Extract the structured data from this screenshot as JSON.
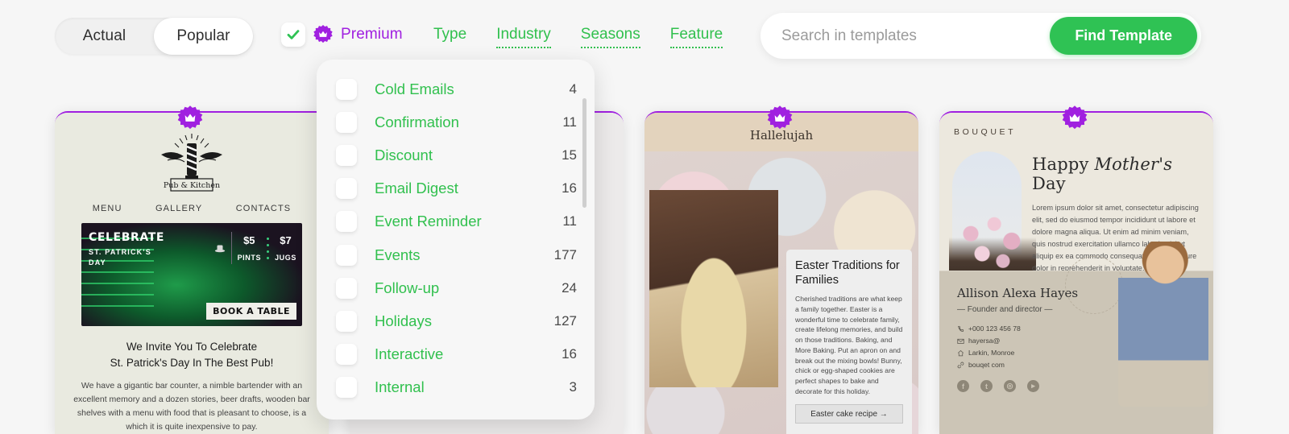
{
  "toolbar": {
    "toggle": {
      "options": [
        "Actual",
        "Popular"
      ],
      "selected": "Popular"
    },
    "premium": {
      "label": "Premium",
      "checked": true,
      "icon": "crown-badge-icon",
      "color": "#a020e0"
    },
    "filters": [
      {
        "label": "Type",
        "active": true
      },
      {
        "label": "Industry",
        "active": false
      },
      {
        "label": "Seasons",
        "active": false
      },
      {
        "label": "Feature",
        "active": false
      }
    ],
    "search": {
      "placeholder": "Search in templates",
      "value": "",
      "button": "Find Template",
      "button_color": "#2fc254"
    }
  },
  "dropdown": {
    "open_for": "Type",
    "items": [
      {
        "label": "Cold Emails",
        "count": "4",
        "checked": false
      },
      {
        "label": "Confirmation",
        "count": "11",
        "checked": false
      },
      {
        "label": "Discount",
        "count": "15",
        "checked": false
      },
      {
        "label": "Email Digest",
        "count": "16",
        "checked": false
      },
      {
        "label": "Event Reminder",
        "count": "11",
        "checked": false
      },
      {
        "label": "Events",
        "count": "177",
        "checked": false
      },
      {
        "label": "Follow-up",
        "count": "24",
        "checked": false
      },
      {
        "label": "Holidays",
        "count": "127",
        "checked": false
      },
      {
        "label": "Interactive",
        "count": "16",
        "checked": false
      },
      {
        "label": "Internal",
        "count": "3",
        "checked": false
      }
    ]
  },
  "cards": {
    "pub": {
      "logo_text": "Pub & Kitchen",
      "nav": [
        "MENU",
        "GALLERY",
        "CONTACTS"
      ],
      "hero": {
        "title": "CELEBRATE",
        "line2": "ST. PATRICK'S",
        "line3": "DAY",
        "price1_amount": "$5",
        "price1_unit": "PINTS",
        "price2_amount": "$7",
        "price2_unit": "JUGS",
        "cta": "BOOK A TABLE"
      },
      "heading_line1": "We Invite You To Celebrate",
      "heading_line2": "St. Patrick's Day In The Best Pub!",
      "body": "We have a gigantic bar counter, a nimble bartender with an excellent memory and a dozen stories, beer drafts, wooden bar shelves with a menu with food that is pleasant to choose, is a which it is quite inexpensive to pay."
    },
    "easter": {
      "brand": "Hallelujah",
      "cross": "✝",
      "title": "Easter Traditions for Families",
      "body": "Cherished traditions are what keep a family together. Easter is a wonderful time to celebrate family, create lifelong memories, and build on those traditions.\nBaking, and More Baking. Put an apron on and break out the mixing bowls! Bunny, chick or egg-shaped cookies are perfect shapes to bake and decorate for this holiday.",
      "cta": "Easter cake recipe →"
    },
    "mothers_day": {
      "brand": "BOUQUET",
      "title_pre": "Happy ",
      "title_em": "Mother's",
      "title_post": " Day",
      "body": "Lorem ipsum dolor sit amet, consectetur adipiscing elit, sed do eiusmod tempor incididunt ut labore et dolore magna aliqua. Ut enim ad minim veniam, quis nostrud exercitation ullamco laboris nisi ut aliquip ex ea commodo consequat. Duis aute irure dolor in reprehenderit in voluptate.",
      "name": "Allison Alexa Hayes",
      "role": "— Founder and director —",
      "phone": "+000 123 456 78",
      "email": "hayersa@",
      "address": "Larkin, Monroe",
      "website": "bouqet com",
      "social": [
        "facebook",
        "tumblr",
        "instagram",
        "youtube"
      ]
    }
  }
}
